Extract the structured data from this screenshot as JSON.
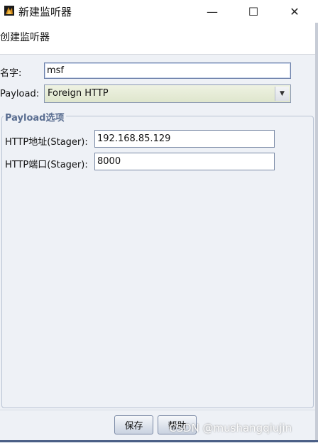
{
  "window": {
    "title": "新建监听器",
    "minimize_glyph": "—",
    "maximize_glyph": "☐",
    "close_glyph": "✕"
  },
  "header": {
    "text": "创建监听器"
  },
  "form": {
    "name_label": "名字:",
    "name_value": "msf",
    "payload_label": "Payload:",
    "payload_value": "Foreign HTTP",
    "payload_arrow": "▼"
  },
  "group": {
    "title": "Payload选项",
    "host_label": "HTTP地址(Stager):",
    "host_value": "192.168.85.129",
    "port_label": "HTTP端口(Stager):",
    "port_value": "8000"
  },
  "buttons": {
    "save": "保存",
    "help": "帮助"
  },
  "watermark": "CSDN @mushangqiujin",
  "colors": {
    "content_bg": "#eef1f6",
    "group_title": "#5a6e91",
    "combo_bg": "#e6ecd6"
  },
  "icons": {
    "app": "app-icon",
    "dropdown": "chevron-down-icon"
  }
}
